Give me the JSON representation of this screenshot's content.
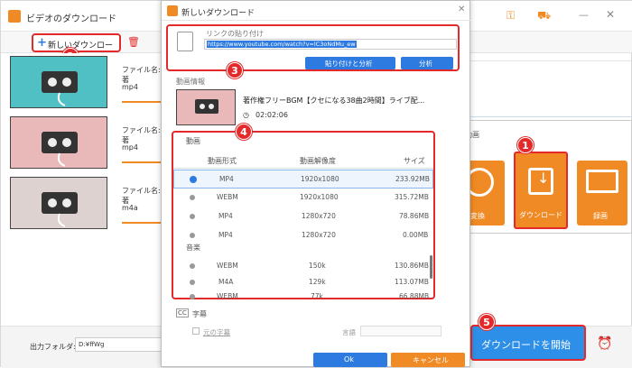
{
  "main": {
    "title": "ビデオのダウンロード",
    "new_download": "新しいダウンロード",
    "items": [
      {
        "filename_label": "ファイル名: 著",
        "format": "mp4"
      },
      {
        "filename_label": "ファイル名: 著",
        "format": "mp4"
      },
      {
        "filename_label": "ファイル名: 著",
        "format": "m4a"
      }
    ],
    "output_label": "出力フォルダ:",
    "output_path": "D:¥ffWg",
    "start_button": "ダウンロードを開始"
  },
  "dialog": {
    "title": "新しいダウンロード",
    "paste_label": "リンクの貼り付け",
    "url": "https://www.youtube.com/watch?v=lC3oNdMu_ew",
    "paste_analyze": "貼り付けと分析",
    "analyze": "分析",
    "video_info_label": "動画情報",
    "video_title": "著作権フリーBGM【クセになる38曲2時間】ライブ配...",
    "duration": "02:02:06",
    "video_section": "動画",
    "col_format": "動画形式",
    "col_resolution": "動画解像度",
    "col_size": "サイズ",
    "video_rows": [
      {
        "format": "MP4",
        "resolution": "1920x1080",
        "size": "233.92MB",
        "selected": true
      },
      {
        "format": "WEBM",
        "resolution": "1920x1080",
        "size": "315.72MB"
      },
      {
        "format": "MP4",
        "resolution": "1280x720",
        "size": "78.86MB"
      },
      {
        "format": "MP4",
        "resolution": "1280x720",
        "size": "0.00MB"
      }
    ],
    "audio_section": "音楽",
    "audio_rows": [
      {
        "format": "WEBM",
        "bitrate": "150k",
        "size": "130.86MB"
      },
      {
        "format": "M4A",
        "bitrate": "129k",
        "size": "113.07MB"
      },
      {
        "format": "WEBM",
        "bitrate": "77k",
        "size": "66.88MB"
      }
    ],
    "subtitle_section": "字幕",
    "original_subtitle": "元の字幕",
    "language_label": "言語",
    "ok": "Ok",
    "cancel": "キャンセル"
  },
  "panel": {
    "header": "動画",
    "convert": "変換",
    "download": "ダウンロード",
    "record": "録画"
  },
  "markers": [
    "1",
    "2",
    "3",
    "4",
    "5"
  ]
}
